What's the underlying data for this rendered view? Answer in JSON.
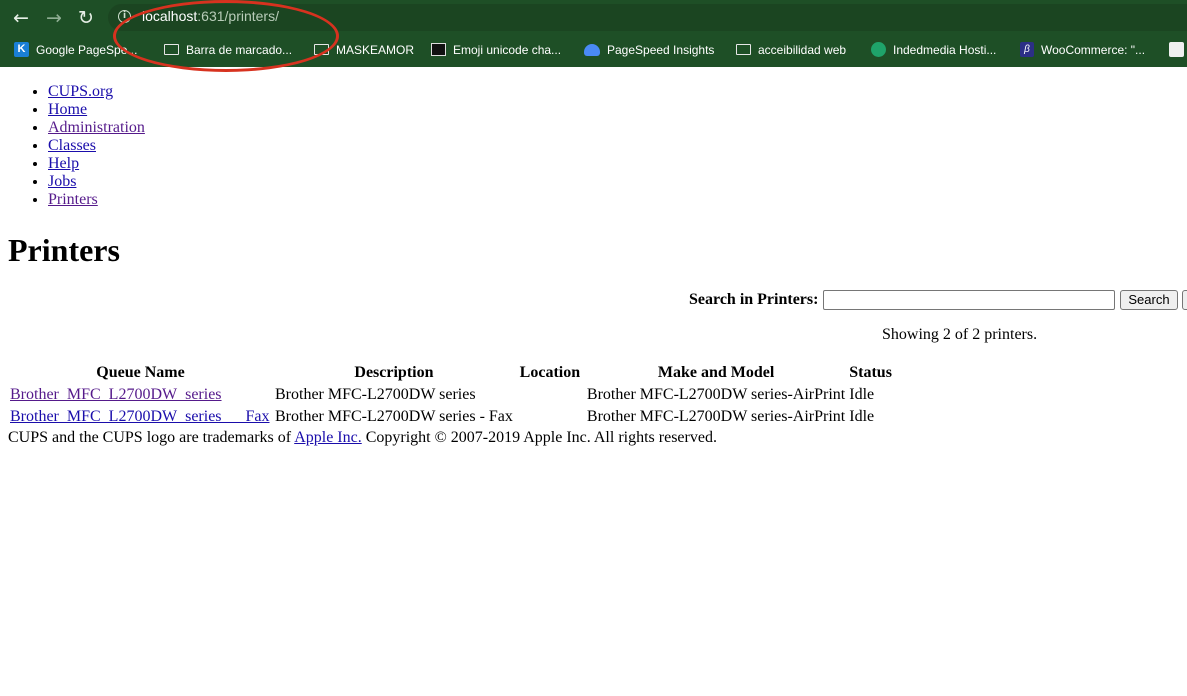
{
  "browser": {
    "url_host": "localhost",
    "url_path": ":631/printers/",
    "bookmarks": [
      {
        "label": "Google PageSpe...",
        "icon": "k-icon"
      },
      {
        "label": "Barra de marcado...",
        "icon": "folder-icon"
      },
      {
        "label": "MASKEAMOR",
        "icon": "folder-icon"
      },
      {
        "label": "Emoji unicode cha...",
        "icon": "terminal-icon"
      },
      {
        "label": "PageSpeed Insights",
        "icon": "pagespeed-icon"
      },
      {
        "label": "acceibilidad web",
        "icon": "folder-icon"
      },
      {
        "label": "Indedmedia Hosti...",
        "icon": "indedmedia-icon"
      },
      {
        "label": "WooCommerce: \"...",
        "icon": "woocommerce-icon"
      }
    ],
    "colors": {
      "chrome": "#1e4f26",
      "annotation": "#d7321f"
    }
  },
  "nav": [
    {
      "label": "CUPS.org",
      "visited": false
    },
    {
      "label": "Home",
      "visited": false
    },
    {
      "label": "Administration",
      "visited": true
    },
    {
      "label": "Classes",
      "visited": false
    },
    {
      "label": "Help",
      "visited": false
    },
    {
      "label": "Jobs",
      "visited": false
    },
    {
      "label": "Printers",
      "visited": true
    }
  ],
  "page": {
    "title": "Printers",
    "search_label": "Search in Printers:",
    "search_value": "",
    "search_button": "Search",
    "showing": "Showing 2 of 2 printers."
  },
  "table": {
    "headers": [
      "Queue Name",
      "Description",
      "Location",
      "Make and Model",
      "Status"
    ],
    "rows": [
      {
        "queue": "Brother_MFC_L2700DW_series",
        "description": "Brother MFC-L2700DW series",
        "location": "",
        "model": "Brother MFC-L2700DW series-AirPrint",
        "status": "Idle"
      },
      {
        "queue": "Brother_MFC_L2700DW_series___Fax",
        "description": "Brother MFC-L2700DW series - Fax",
        "location": "",
        "model": "Brother MFC-L2700DW series-AirPrint",
        "status": "Idle"
      }
    ]
  },
  "footer": {
    "prefix": "CUPS and the CUPS logo are trademarks of ",
    "link": "Apple Inc.",
    "suffix": " Copyright © 2007-2019 Apple Inc. All rights reserved."
  }
}
